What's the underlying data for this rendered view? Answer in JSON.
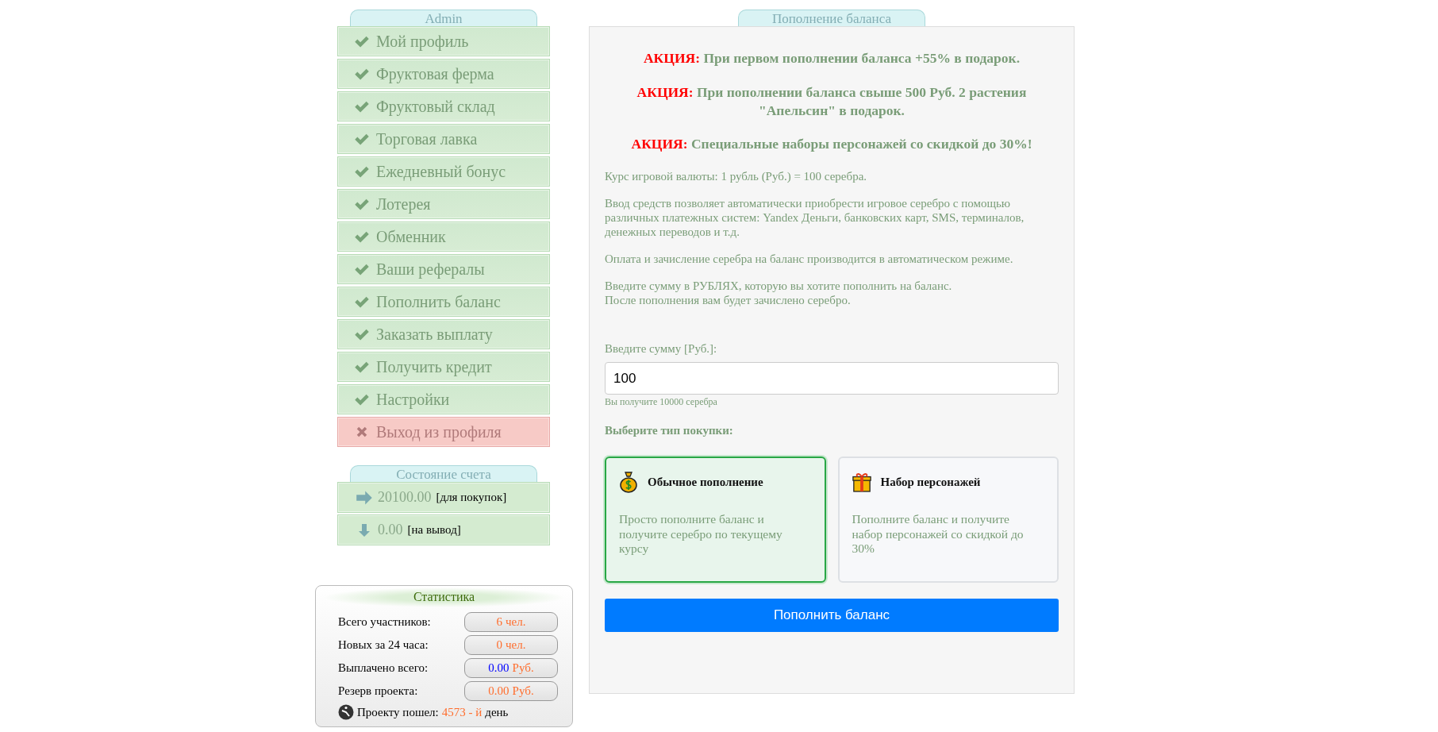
{
  "menu": {
    "title": "Admin",
    "items": [
      {
        "label": "Мой профиль",
        "kind": "link"
      },
      {
        "label": "Фруктовая ферма",
        "kind": "link"
      },
      {
        "label": "Фруктовый склад",
        "kind": "link"
      },
      {
        "label": "Торговая лавка",
        "kind": "link"
      },
      {
        "label": "Ежедневный бонус",
        "kind": "link"
      },
      {
        "label": "Лотерея",
        "kind": "link"
      },
      {
        "label": "Обменник",
        "kind": "link"
      },
      {
        "label": "Ваши рефералы",
        "kind": "link"
      },
      {
        "label": "Пополнить баланс",
        "kind": "link"
      },
      {
        "label": "Заказать выплату",
        "kind": "link"
      },
      {
        "label": "Получить кредит",
        "kind": "link"
      },
      {
        "label": "Настройки",
        "kind": "link"
      },
      {
        "label": "Выход из профиля",
        "kind": "logout"
      }
    ]
  },
  "account": {
    "title": "Состояние счета",
    "rows": [
      {
        "kind": "purchase",
        "amount": "20100.00",
        "label": "[для покупок]"
      },
      {
        "kind": "withdraw",
        "amount": "0.00",
        "label": "[на вывод]"
      }
    ]
  },
  "stats": {
    "title": "Статистика",
    "rows": [
      {
        "label": "Всего участников:",
        "value": "6",
        "unit": "чел.",
        "color": "#ff6e2e"
      },
      {
        "label": "Новых за 24 часа:",
        "value": "0",
        "unit": "чел.",
        "color": "#ff6e2e"
      },
      {
        "label": "Выплачено всего:",
        "value": "0.00",
        "unit": "Руб.",
        "color": "#0000ff"
      },
      {
        "label": "Резерв проекта:",
        "value": "0.00",
        "unit": "Руб.",
        "color": "#ff6e2e"
      }
    ],
    "footer": {
      "label": "Проекту пошел:",
      "value": "4573 - й",
      "suffix": "день"
    }
  },
  "panel": {
    "title": "Пополнение баланса",
    "promos": [
      {
        "label": "АКЦИЯ:",
        "text": "При первом пополнении баланса +55% в подарок."
      },
      {
        "label": "АКЦИЯ:",
        "text": "При пополнении баланса свыше 500 Руб. 2 растения \"Апельсин\" в подарок."
      },
      {
        "label": "АКЦИЯ:",
        "text": "Специальные наборы персонажей со скидкой до 30%!"
      }
    ],
    "paragraphs": [
      [
        "Курс игровой валюты: 1 рубль (Руб.) = 100 серебра."
      ],
      [
        "Ввод средств позволяет автоматически приобрести игровое серебро с помощью различных платежных систем: Yandex Деньги, банковских карт, SMS, терминалов, денежных переводов и т.д."
      ],
      [
        "Оплата и зачисление серебра на баланс производится в автоматическом режиме."
      ],
      [
        "Введите сумму в РУБЛЯХ, которую вы хотите пополнить на баланс.",
        "После пополнения вам будет зачислено серебро."
      ]
    ],
    "amount_label": "Введите сумму [Руб.]:",
    "amount_value": "100",
    "amount_hint": "Вы получите 10000 серебра",
    "type_label": "Выберите тип покупки:",
    "options": [
      {
        "kind": "money",
        "title": "Обычное пополнение",
        "text": "Просто пополните баланс и получите серебро по текущему курсу",
        "selected": true
      },
      {
        "kind": "gift",
        "title": "Набор персонажей",
        "text": "Пополните баланс и получите набор персонажей со скидкой до 30%",
        "selected": false
      }
    ],
    "submit": "Пополнить баланс"
  }
}
